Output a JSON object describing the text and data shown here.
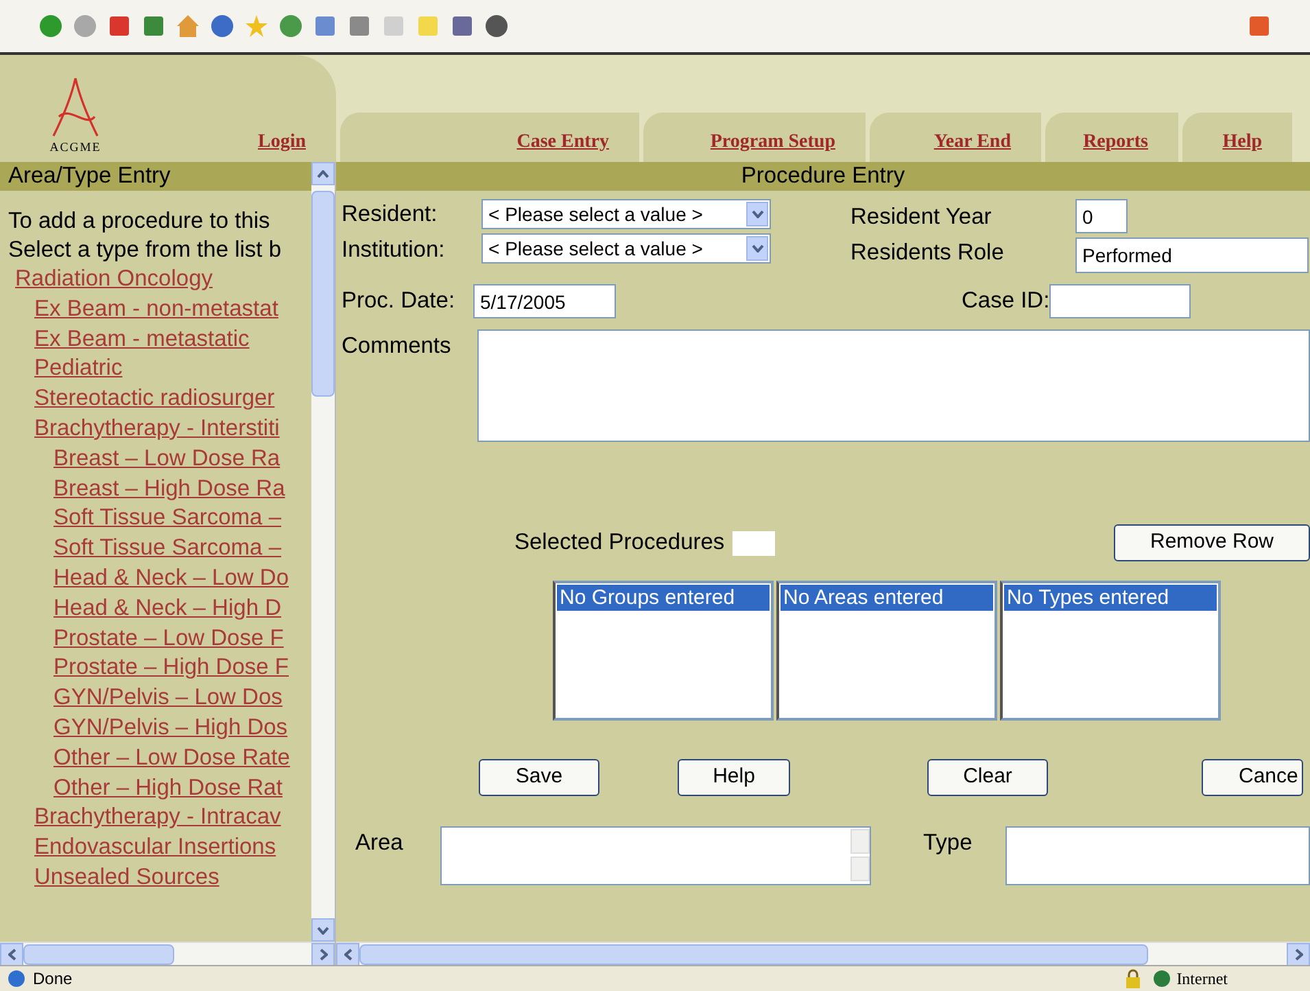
{
  "nav": {
    "logo": "ACGME",
    "tabs": [
      {
        "label": "Login"
      },
      {
        "label": "Case Entry"
      },
      {
        "label": "Program Setup"
      },
      {
        "label": "Year End"
      },
      {
        "label": "Reports"
      },
      {
        "label": "Help"
      }
    ]
  },
  "sidebar": {
    "title": "Area/Type Entry",
    "intro": [
      "To add a procedure to this",
      "Select a type from the list b"
    ],
    "tree": [
      {
        "label": "Radiation Oncology",
        "children": [
          {
            "label": "Ex Beam - non-metastat"
          },
          {
            "label": "Ex Beam - metastatic "
          },
          {
            "label": "Pediatric"
          },
          {
            "label": "Stereotactic radiosurger"
          },
          {
            "label": "Brachytherapy - Interstiti",
            "children": [
              {
                "label": "Breast – Low Dose Ra"
              },
              {
                "label": "Breast – High Dose Ra"
              },
              {
                "label": "Soft Tissue Sarcoma –"
              },
              {
                "label": "Soft Tissue Sarcoma –"
              },
              {
                "label": "Head & Neck – Low Do"
              },
              {
                "label": "Head & Neck – High D"
              },
              {
                "label": "Prostate – Low Dose F"
              },
              {
                "label": "Prostate – High Dose F"
              },
              {
                "label": "GYN/Pelvis – Low Dos"
              },
              {
                "label": "GYN/Pelvis – High Dos"
              },
              {
                "label": "Other – Low Dose Rate"
              },
              {
                "label": "Other – High Dose Rat"
              }
            ]
          },
          {
            "label": "Brachytherapy - Intracav"
          },
          {
            "label": "Endovascular Insertions"
          },
          {
            "label": "Unsealed Sources"
          }
        ]
      }
    ]
  },
  "form": {
    "title": "Procedure Entry",
    "resident": {
      "label": "Resident:",
      "value": "< Please select a value >"
    },
    "institution": {
      "label": "Institution:",
      "value": "< Please select a value >"
    },
    "resident_year": {
      "label": "Resident Year",
      "value": "0"
    },
    "residents_role": {
      "label": "Residents Role",
      "value": "Performed"
    },
    "proc_date": {
      "label": "Proc. Date:",
      "value": "5/17/2005"
    },
    "case_id": {
      "label": "Case ID:"
    },
    "comments": {
      "label": "Comments"
    },
    "selected_label": "Selected Procedures",
    "remove_row": "Remove Row",
    "lists": [
      {
        "items": [
          {
            "label": "No Groups entered",
            "selected": true
          }
        ]
      },
      {
        "items": [
          {
            "label": "No Areas entered",
            "selected": true
          }
        ]
      },
      {
        "items": [
          {
            "label": "No Types entered",
            "selected": true
          }
        ]
      }
    ],
    "buttons": [
      "Save",
      "Help",
      "Clear",
      "Cance"
    ],
    "area": {
      "label": "Area"
    },
    "type": {
      "label": "Type"
    }
  },
  "status_bar": {
    "text": "Done",
    "zone": "Internet"
  }
}
